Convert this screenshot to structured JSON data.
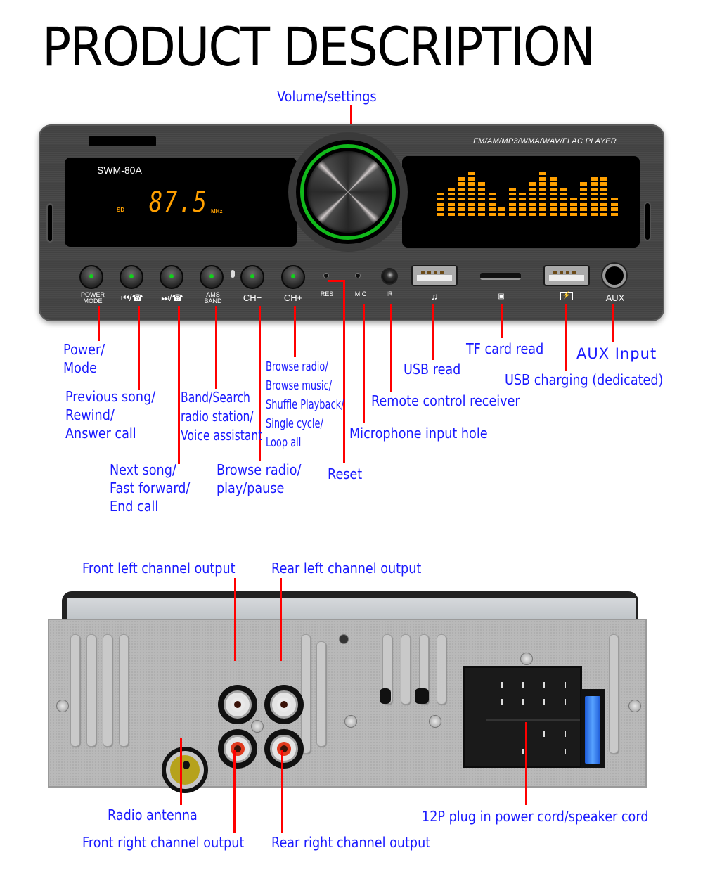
{
  "page": {
    "title": "PRODUCT DESCRIPTION"
  },
  "front_panel": {
    "model": "SWM-80A",
    "formats": "FM/AM/MP3/WMA/WAV/FLAC PLAYER",
    "display": {
      "source": "SD",
      "frequency": "87.5",
      "unit": "MHz"
    },
    "equalizer_levels": [
      5,
      6,
      8,
      9,
      7,
      5,
      2,
      6,
      5,
      7,
      9,
      8,
      6,
      4,
      7,
      8,
      8,
      4
    ],
    "buttons": [
      {
        "id": "power-mode",
        "label_line1": "POWER",
        "label_line2": "MODE"
      },
      {
        "id": "prev",
        "label": "⏮/☎"
      },
      {
        "id": "next",
        "label": "⏭/☎"
      },
      {
        "id": "ams-band",
        "label_line1": "AMS",
        "label_line2": "BAND"
      },
      {
        "id": "ch-minus",
        "label": "CH−"
      },
      {
        "id": "ch-plus",
        "label": "CH+"
      }
    ],
    "port_labels": {
      "res": "RES",
      "mic": "MIC",
      "ir": "IR",
      "usb_music_icon": "♫",
      "tf_folder_icon": "▣",
      "usb_charge_icon": "⚡",
      "aux": "AUX"
    },
    "accent_colors": {
      "display": "#ffa000",
      "led": "#14d01e",
      "ring": "#11b91b"
    }
  },
  "front_callouts": {
    "volume": "Volume/settings",
    "power": [
      "Power/",
      "Mode"
    ],
    "previous": [
      "Previous song/",
      "Rewind/",
      "Answer call"
    ],
    "next": [
      "Next song/",
      "Fast forward/",
      "End call"
    ],
    "band": [
      "Band/Search",
      "radio station/",
      "Voice assistant"
    ],
    "ch_minus": [
      "Browse radio/",
      "play/pause"
    ],
    "ch_plus": [
      "Browse radio/",
      "Browse music/",
      "Shuffle Playback/",
      "Single cycle/",
      "Loop all"
    ],
    "reset": "Reset",
    "mic": "Microphone input hole",
    "ir": "Remote control receiver",
    "usb_read": "USB read",
    "tf": "TF card read",
    "usb_charge": "USB charging (dedicated)",
    "aux": "AUX Input"
  },
  "back_callouts": {
    "front_left": "Front left channel output",
    "rear_left": "Rear left channel output",
    "antenna": "Radio antenna",
    "front_right": "Front right channel output",
    "rear_right": "Rear right channel output",
    "iso_plug": "12P plug in power cord/speaker cord"
  },
  "callout_color": "#1a1aff",
  "line_color": "#ff0000"
}
